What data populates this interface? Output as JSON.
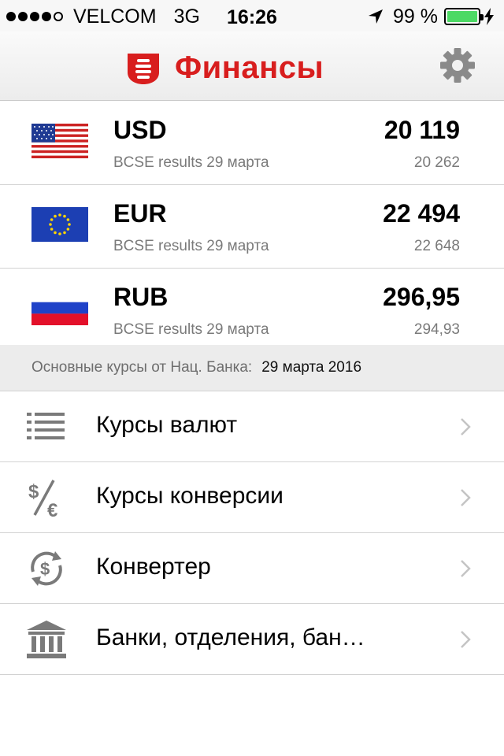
{
  "status_bar": {
    "carrier": "VELCOM",
    "network": "3G",
    "time": "16:26",
    "battery": "99 %",
    "battery_level": 0.99,
    "signal_bars_filled": 4,
    "signal_bars_total": 5,
    "battery_color": "#4cd964"
  },
  "header": {
    "title": "Финансы",
    "brand_color": "#d81e1e",
    "logo_icon": "finance-logo-icon",
    "settings_icon": "gear-icon"
  },
  "rates": [
    {
      "flag": "usa-flag-icon",
      "code": "USD",
      "source": "BCSE results 29 марта",
      "value": "20 119",
      "previous": "20 262"
    },
    {
      "flag": "eu-flag-icon",
      "code": "EUR",
      "source": "BCSE results 29 марта",
      "value": "22 494",
      "previous": "22 648"
    },
    {
      "flag": "russia-flag-icon",
      "code": "RUB",
      "source": "BCSE results 29 марта",
      "value": "296,95",
      "previous": "294,93"
    }
  ],
  "nbrb": {
    "label": "Основные курсы от Нац. Банка:",
    "date": "29 марта 2016"
  },
  "menu": [
    {
      "label": "Курсы валют",
      "icon": "list-icon"
    },
    {
      "label": "Курсы конверсии",
      "icon": "dollar-euro-icon"
    },
    {
      "label": "Конвертер",
      "icon": "currency-exchange-icon"
    },
    {
      "label": "Банки, отделения, бан…",
      "icon": "bank-icon"
    }
  ]
}
